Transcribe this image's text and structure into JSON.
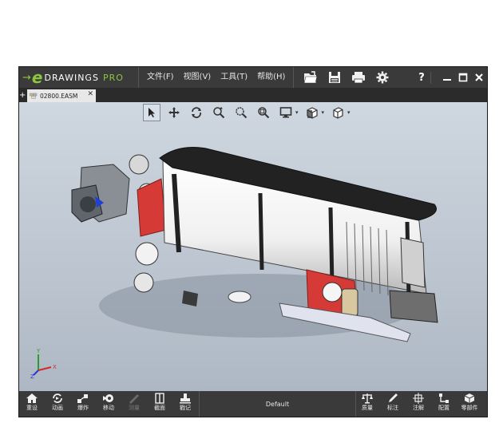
{
  "app": {
    "logo_text": "DRAWINGS",
    "logo_pro": "PRO",
    "menu": [
      {
        "label": "文件(F)"
      },
      {
        "label": "视图(V)"
      },
      {
        "label": "工具(T)"
      },
      {
        "label": "帮助(H)"
      }
    ],
    "help": "?"
  },
  "tabs": [
    {
      "label": "02800.EASM"
    }
  ],
  "configuration": "Default",
  "bottom_left": [
    {
      "label": "重设",
      "icon": "home-icon"
    },
    {
      "label": "动画",
      "icon": "animate-icon"
    },
    {
      "label": "爆炸",
      "icon": "explode-icon"
    },
    {
      "label": "移动",
      "icon": "move-icon"
    },
    {
      "label": "测量",
      "icon": "measure-icon"
    },
    {
      "label": "截面",
      "icon": "section-icon"
    },
    {
      "label": "戳记",
      "icon": "stamp-icon"
    }
  ],
  "bottom_right": [
    {
      "label": "质量",
      "icon": "mass-icon"
    },
    {
      "label": "标注",
      "icon": "markup-icon"
    },
    {
      "label": "注解",
      "icon": "annotation-icon"
    },
    {
      "label": "配置",
      "icon": "config-icon"
    },
    {
      "label": "零部件",
      "icon": "components-icon"
    }
  ],
  "colors": {
    "brand_green": "#8cc63f",
    "frame_dark": "#3a3a3a",
    "engine_red": "#d63a36"
  },
  "triad": {
    "x": "X",
    "y": "Y",
    "z": "Z"
  }
}
